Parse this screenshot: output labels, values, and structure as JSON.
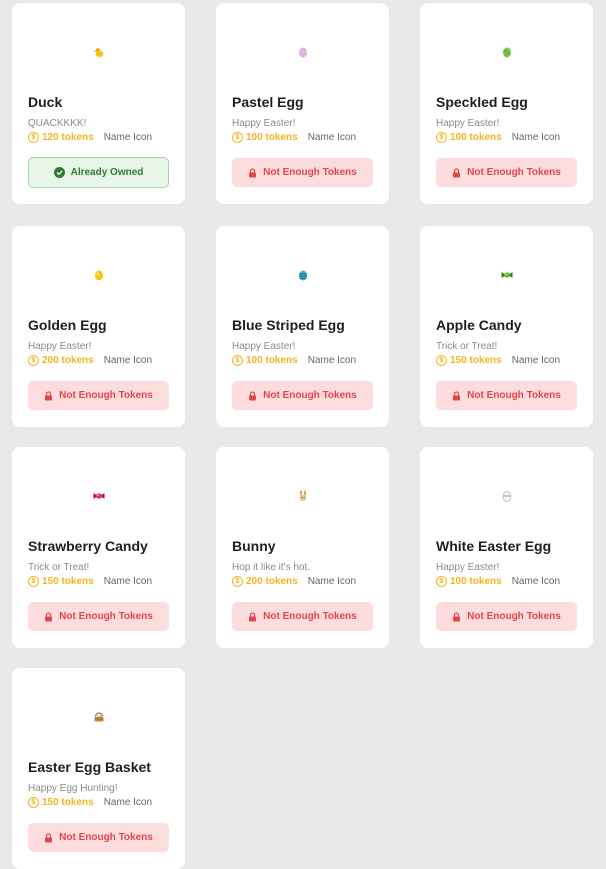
{
  "store": {
    "items": [
      {
        "name": "Duck",
        "description": "QUACKKKK!",
        "price": "120 tokens",
        "secondary": "Name Icon",
        "button": "Already Owned",
        "owned": true,
        "icon": "duck-icon"
      },
      {
        "name": "Pastel Egg",
        "description": "Happy Easter!",
        "price": "100 tokens",
        "secondary": "Name Icon",
        "button": "Not Enough Tokens",
        "owned": false,
        "icon": "pastel-egg-icon"
      },
      {
        "name": "Speckled Egg",
        "description": "Happy Easter!",
        "price": "100 tokens",
        "secondary": "Name Icon",
        "button": "Not Enough Tokens",
        "owned": false,
        "icon": "speckled-egg-icon"
      },
      {
        "name": "Golden Egg",
        "description": "Happy Easter!",
        "price": "200 tokens",
        "secondary": "Name Icon",
        "button": "Not Enough Tokens",
        "owned": false,
        "icon": "golden-egg-icon"
      },
      {
        "name": "Blue Striped Egg",
        "description": "Happy Easter!",
        "price": "100 tokens",
        "secondary": "Name Icon",
        "button": "Not Enough Tokens",
        "owned": false,
        "icon": "blue-striped-egg-icon"
      },
      {
        "name": "Apple Candy",
        "description": "Trick or Treat!",
        "price": "150 tokens",
        "secondary": "Name Icon",
        "button": "Not Enough Tokens",
        "owned": false,
        "icon": "apple-candy-icon"
      },
      {
        "name": "Strawberry Candy",
        "description": "Trick or Treat!",
        "price": "150 tokens",
        "secondary": "Name Icon",
        "button": "Not Enough Tokens",
        "owned": false,
        "icon": "strawberry-candy-icon"
      },
      {
        "name": "Bunny",
        "description": "Hop it like it's hot.",
        "price": "200 tokens",
        "secondary": "Name Icon",
        "button": "Not Enough Tokens",
        "owned": false,
        "icon": "bunny-icon"
      },
      {
        "name": "White Easter Egg",
        "description": "Happy Easter!",
        "price": "100 tokens",
        "secondary": "Name Icon",
        "button": "Not Enough Tokens",
        "owned": false,
        "icon": "white-easter-egg-icon"
      },
      {
        "name": "Easter Egg Basket",
        "description": "Happy Egg Hunting!",
        "price": "150 tokens",
        "secondary": "Name Icon",
        "button": "Not Enough Tokens",
        "owned": false,
        "icon": "easter-egg-basket-icon"
      }
    ],
    "coin_symbol": "$",
    "colors": {
      "token": "#f2b51e",
      "not_enough_bg": "#fcdcdc",
      "not_enough_text": "#e0474c",
      "owned_bg": "#e8f5e9",
      "owned_text": "#2e7d32"
    }
  }
}
